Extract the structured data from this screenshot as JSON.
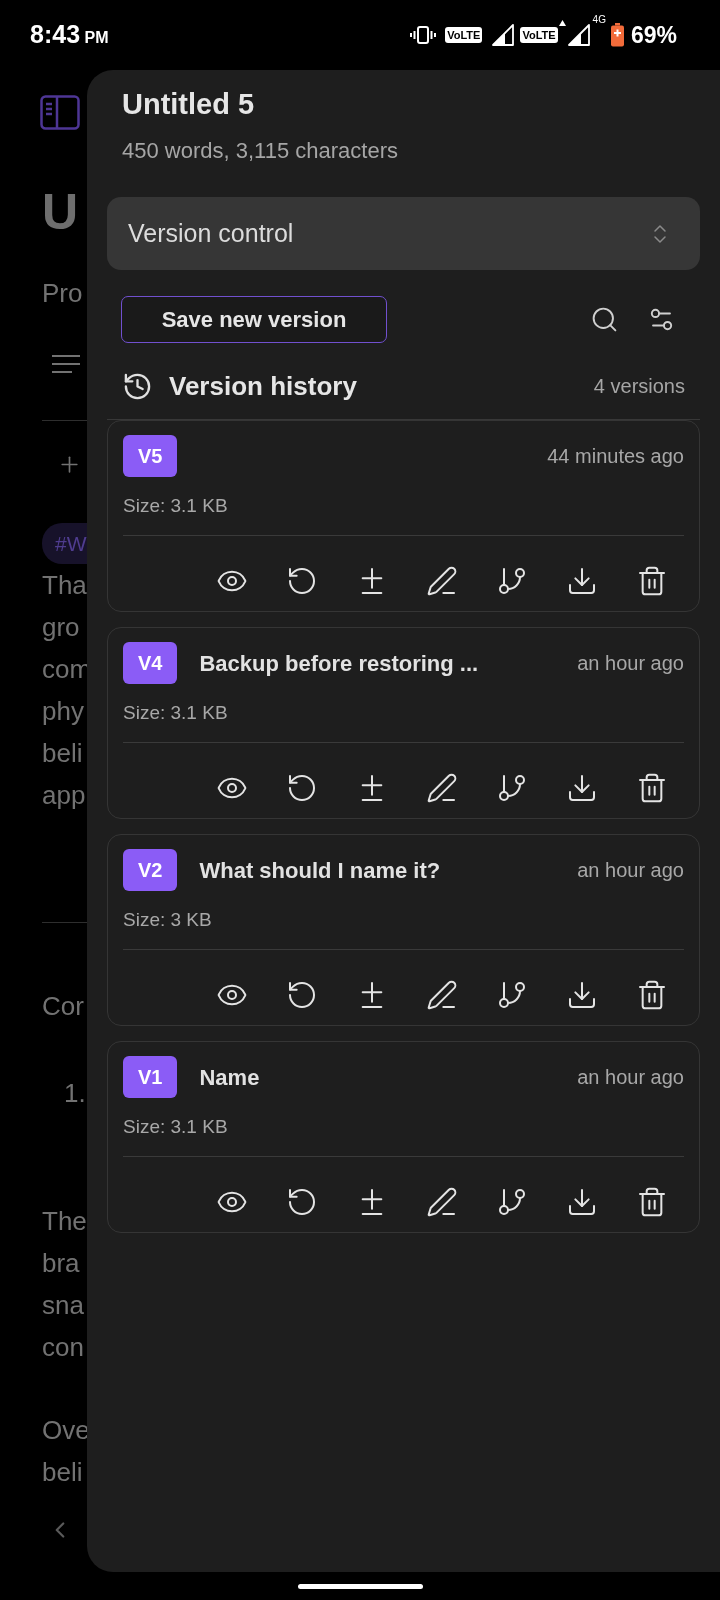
{
  "status_bar": {
    "time": "8:43",
    "period": "PM",
    "volte_labels": [
      "VoLTE",
      "VoLTE"
    ],
    "network_type": "4G",
    "battery": "69%"
  },
  "background_page": {
    "title": "U",
    "subtitle": "Pro",
    "tag": "#W",
    "paragraph_1": [
      "Tha",
      "gro",
      "com",
      "phy",
      "beli",
      "app"
    ],
    "heading": "Cor",
    "list_item": "1.",
    "paragraph_2": [
      "The",
      "bra",
      "sna",
      "con"
    ],
    "paragraph_3": [
      "Ove",
      "beli"
    ]
  },
  "panel": {
    "title": "Untitled 5",
    "stats": "450 words, 3,115 characters",
    "dropdown": {
      "value": "Version control"
    },
    "save_button": "Save new version",
    "history": {
      "title": "Version history",
      "count": "4 versions"
    },
    "versions": [
      {
        "badge": "V5",
        "time": "44 minutes ago",
        "size": "Size: 3.1 KB"
      },
      {
        "badge": "V4",
        "name": "Backup before restoring ...",
        "time": "an hour ago",
        "size": "Size: 3.1 KB"
      },
      {
        "badge": "V2",
        "name": "What should I name it?",
        "time": "an hour ago",
        "size": "Size: 3 KB"
      },
      {
        "badge": "V1",
        "name": "Name",
        "time": "an hour ago",
        "size": "Size: 3.1 KB"
      }
    ]
  }
}
